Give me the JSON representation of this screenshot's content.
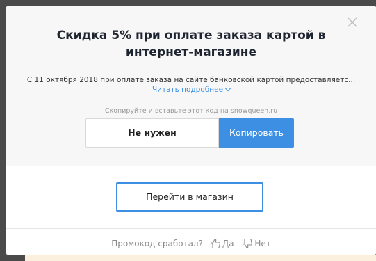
{
  "promo": {
    "title_line1": "Скидка 5% при оплате заказа картой в",
    "title_line2": "интернет-магазине",
    "description": "С 11 октября 2018 при оплате заказа на сайте банковской картой предоставляетс...",
    "read_more": "Читать подробнее",
    "copy_hint": "Скопируйте и вставьте этот код на snowqueen.ru",
    "code": "Не нужен",
    "copy_button": "Копировать",
    "shop_button": "Перейти в магазин"
  },
  "feedback": {
    "question": "Промокод сработал?",
    "yes": "Да",
    "no": "Нет"
  },
  "icons": {
    "close": "close-icon",
    "chevron": "chevron-down-icon",
    "like": "thumbs-up-icon",
    "dislike": "thumbs-down-icon"
  },
  "colors": {
    "accent": "#3d8fe3",
    "title": "#1f2530",
    "muted": "#8a8a8a",
    "panel": "#f7f7f7"
  }
}
